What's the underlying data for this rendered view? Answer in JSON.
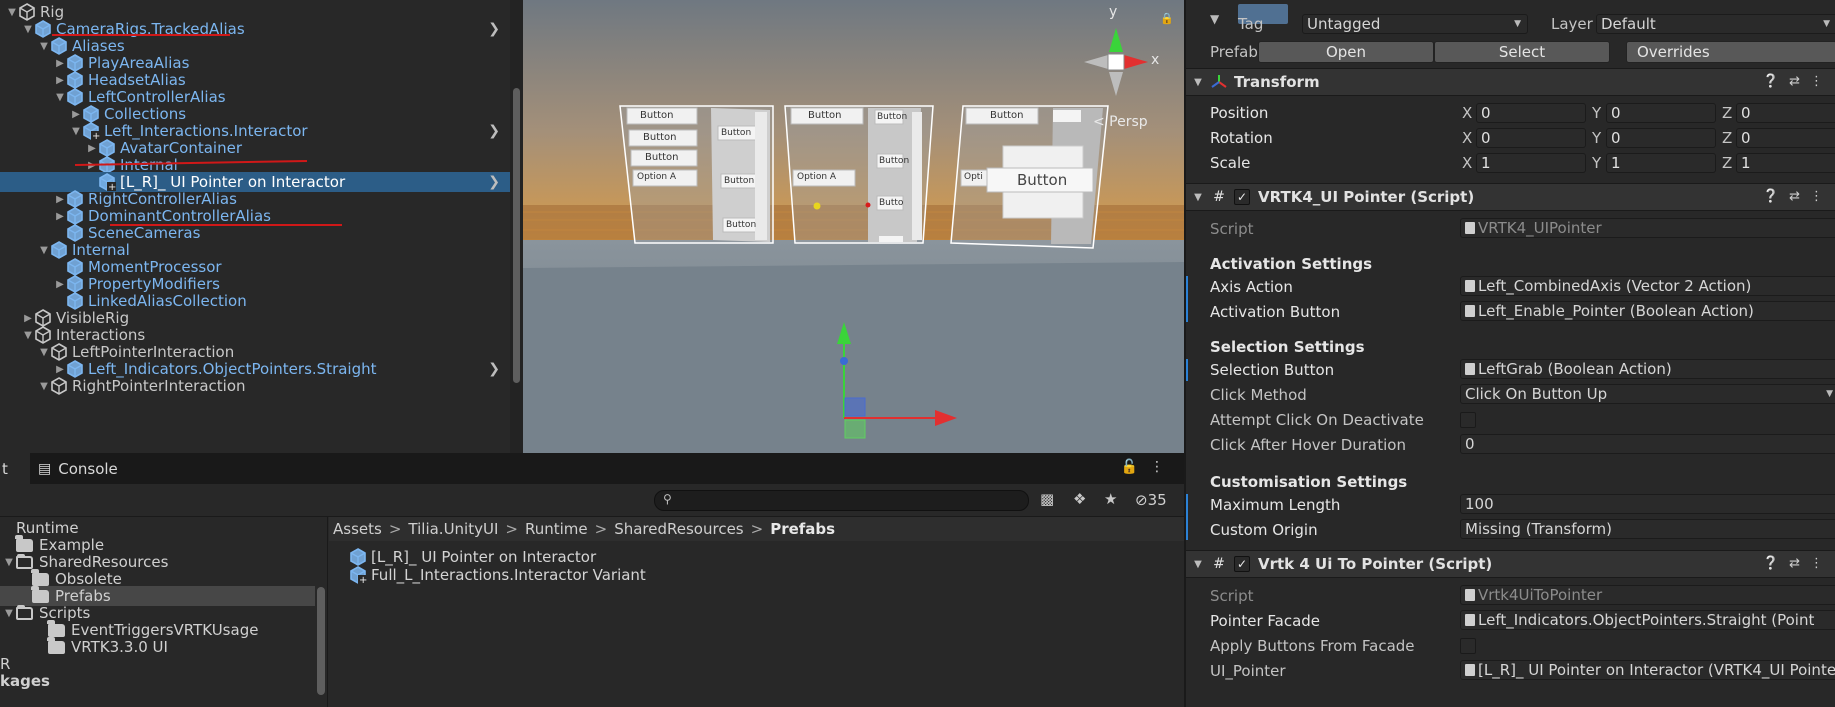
{
  "hierarchy": {
    "items": [
      {
        "label": "Rig",
        "depth": 0,
        "fold": "open",
        "kind": "gameobject"
      },
      {
        "label": "CameraRigs.TrackedAlias",
        "depth": 1,
        "fold": "open",
        "kind": "prefab",
        "arrow": true
      },
      {
        "label": "Aliases",
        "depth": 2,
        "fold": "open",
        "kind": "prefab"
      },
      {
        "label": "PlayAreaAlias",
        "depth": 3,
        "fold": "closed",
        "kind": "prefab"
      },
      {
        "label": "HeadsetAlias",
        "depth": 3,
        "fold": "closed",
        "kind": "prefab"
      },
      {
        "label": "LeftControllerAlias",
        "depth": 3,
        "fold": "open",
        "kind": "prefab"
      },
      {
        "label": "Collections",
        "depth": 4,
        "fold": "closed",
        "kind": "prefab"
      },
      {
        "label": "Left_Interactions.Interactor",
        "depth": 4,
        "fold": "open",
        "kind": "prefab-added",
        "arrow": true
      },
      {
        "label": "AvatarContainer",
        "depth": 5,
        "fold": "closed",
        "kind": "prefab"
      },
      {
        "label": "Internal",
        "depth": 5,
        "fold": "closed",
        "kind": "prefab"
      },
      {
        "label": "[L_R]_ UI Pointer on Interactor",
        "depth": 5,
        "fold": "none",
        "kind": "prefab-added",
        "arrow": true,
        "selected": true
      },
      {
        "label": "RightControllerAlias",
        "depth": 3,
        "fold": "closed",
        "kind": "prefab"
      },
      {
        "label": "DominantControllerAlias",
        "depth": 3,
        "fold": "closed",
        "kind": "prefab"
      },
      {
        "label": "SceneCameras",
        "depth": 3,
        "fold": "none",
        "kind": "prefab"
      },
      {
        "label": "Internal",
        "depth": 2,
        "fold": "open",
        "kind": "prefab"
      },
      {
        "label": "MomentProcessor",
        "depth": 3,
        "fold": "none",
        "kind": "prefab"
      },
      {
        "label": "PropertyModifiers",
        "depth": 3,
        "fold": "closed",
        "kind": "prefab"
      },
      {
        "label": "LinkedAliasCollection",
        "depth": 3,
        "fold": "none",
        "kind": "prefab"
      },
      {
        "label": "VisibleRig",
        "depth": 1,
        "fold": "closed",
        "kind": "gameobject"
      },
      {
        "label": "Interactions",
        "depth": 1,
        "fold": "open",
        "kind": "gameobject"
      },
      {
        "label": "LeftPointerInteraction",
        "depth": 2,
        "fold": "open",
        "kind": "gameobject"
      },
      {
        "label": "Left_Indicators.ObjectPointers.Straight",
        "depth": 3,
        "fold": "closed",
        "kind": "prefab",
        "arrow": true
      },
      {
        "label": "RightPointerInteraction",
        "depth": 2,
        "fold": "open",
        "kind": "gameobject"
      }
    ]
  },
  "scene": {
    "persp_label": "< Persp",
    "gizmo": {
      "y": "y",
      "x": "x"
    },
    "panels": {
      "left": {
        "buttons": [
          "Button",
          "Button",
          "Button"
        ],
        "dropdown": "Option A",
        "side": [
          "Button",
          "Button",
          "Button",
          "Button"
        ]
      },
      "middle": {
        "button": "Button",
        "dropdown": "Option A",
        "side": [
          "Button",
          "Button",
          "Butto",
          "Butto"
        ]
      },
      "right": {
        "button": "Button",
        "dropdown": "Opti",
        "big_button": "Button"
      }
    }
  },
  "bottom": {
    "tabs": {
      "left_fragment": "t",
      "console": "Console"
    },
    "search": {
      "placeholder": ""
    },
    "hidden_count": "35",
    "folders": [
      {
        "label": "Runtime",
        "depth": 0,
        "fold": "none",
        "icon": "none"
      },
      {
        "label": "Example",
        "depth": 0,
        "fold": "none",
        "icon": "folder"
      },
      {
        "label": "SharedResources",
        "depth": 0,
        "fold": "open",
        "icon": "folder-open"
      },
      {
        "label": "Obsolete",
        "depth": 1,
        "fold": "none",
        "icon": "folder"
      },
      {
        "label": "Prefabs",
        "depth": 1,
        "fold": "none",
        "icon": "folder",
        "selected": true
      },
      {
        "label": "Scripts",
        "depth": 0,
        "fold": "open",
        "icon": "folder-open"
      },
      {
        "label": "EventTriggersVRTKUsage",
        "depth": 2,
        "fold": "none",
        "icon": "folder"
      },
      {
        "label": "VRTK3.3.0 UI",
        "depth": 2,
        "fold": "none",
        "icon": "folder"
      },
      {
        "label": "R",
        "depth": -1,
        "fold": "none",
        "icon": "none"
      },
      {
        "label": "kages",
        "depth": -1,
        "fold": "none",
        "icon": "none",
        "bold": true
      }
    ],
    "breadcrumb": [
      "Assets",
      "Tilia.UnityUI",
      "Runtime",
      "SharedResources",
      "Prefabs"
    ],
    "assets": [
      {
        "label": "[L_R]_ UI Pointer on Interactor",
        "icon": "prefab-icon"
      },
      {
        "label": "Full_L_Interactions.Interactor Variant",
        "icon": "prefab-variant-icon"
      }
    ]
  },
  "inspector": {
    "header": {
      "tag_label": "Tag",
      "tag_value": "Untagged",
      "layer_label": "Layer",
      "layer_value": "Default",
      "prefab_label": "Prefab",
      "open": "Open",
      "select": "Select",
      "overrides": "Overrides"
    },
    "transform": {
      "title": "Transform",
      "rows": [
        {
          "label": "Position",
          "x": "0",
          "y": "0",
          "z": "0"
        },
        {
          "label": "Rotation",
          "x": "0",
          "y": "0",
          "z": "0"
        },
        {
          "label": "Scale",
          "x": "1",
          "y": "1",
          "z": "1"
        }
      ],
      "axes": {
        "x": "X",
        "y": "Y",
        "z": "Z"
      }
    },
    "ui_pointer": {
      "title": "VRTK4_UI Pointer (Script)",
      "script_label": "Script",
      "script_value": "VRTK4_UIPointer",
      "activation_title": "Activation Settings",
      "axis_action_label": "Axis Action",
      "axis_action_value": "Left_CombinedAxis (Vector 2 Action)",
      "activation_button_label": "Activation Button",
      "activation_button_value": "Left_Enable_Pointer (Boolean Action)",
      "selection_title": "Selection Settings",
      "selection_button_label": "Selection Button",
      "selection_button_value": "LeftGrab (Boolean Action)",
      "click_method_label": "Click Method",
      "click_method_value": "Click On Button Up",
      "attempt_click_label": "Attempt Click On Deactivate",
      "click_after_label": "Click After Hover Duration",
      "click_after_value": "0",
      "custom_title": "Customisation Settings",
      "max_length_label": "Maximum Length",
      "max_length_value": "100",
      "custom_origin_label": "Custom Origin",
      "custom_origin_value": "Missing (Transform)"
    },
    "ui_to_pointer": {
      "title": "Vrtk 4 Ui To Pointer (Script)",
      "script_label": "Script",
      "script_value": "Vrtk4UiToPointer",
      "pointer_facade_label": "Pointer Facade",
      "pointer_facade_value": "Left_Indicators.ObjectPointers.Straight (Point",
      "apply_buttons_label": "Apply Buttons From Facade",
      "ui_pointer_label": "UI_Pointer",
      "ui_pointer_value": "[L_R]_ UI Pointer on Interactor (VRTK4_UI Pointe"
    }
  }
}
